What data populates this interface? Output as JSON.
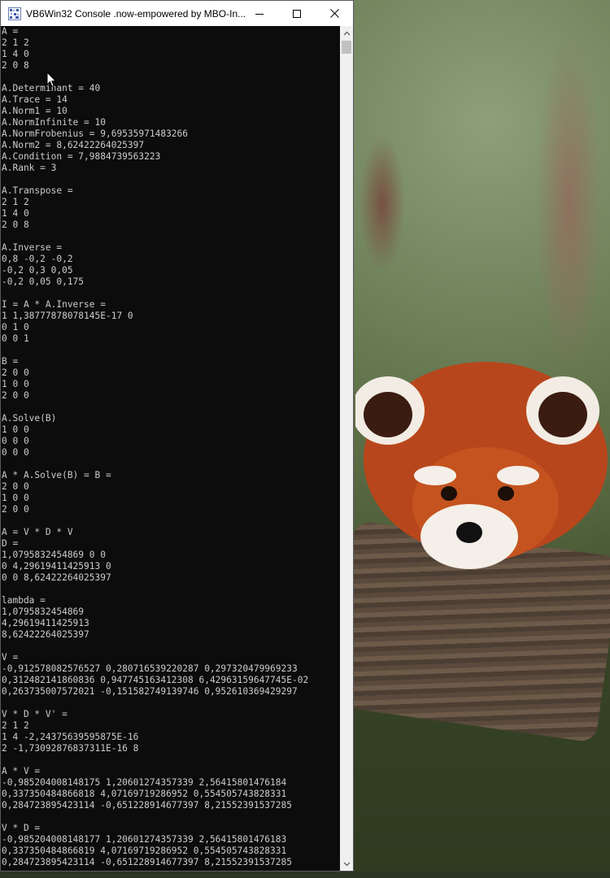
{
  "window": {
    "title": "VB6Win32 Console .now-empowered by MBO-In..."
  },
  "console": {
    "lines": [
      "A =",
      "2 1 2",
      "1 4 0",
      "2 0 8",
      "",
      "A.Determinant = 40",
      "A.Trace = 14",
      "A.Norm1 = 10",
      "A.NormInfinite = 10",
      "A.NormFrobenius = 9,69535971483266",
      "A.Norm2 = 8,62422264025397",
      "A.Condition = 7,9884739563223",
      "A.Rank = 3",
      "",
      "A.Transpose =",
      "2 1 2",
      "1 4 0",
      "2 0 8",
      "",
      "A.Inverse =",
      "0,8 -0,2 -0,2",
      "-0,2 0,3 0,05",
      "-0,2 0,05 0,175",
      "",
      "I = A * A.Inverse =",
      "1 1,38777878078145E-17 0",
      "0 1 0",
      "0 0 1",
      "",
      "B =",
      "2 0 0",
      "1 0 0",
      "2 0 0",
      "",
      "A.Solve(B)",
      "1 0 0",
      "0 0 0",
      "0 0 0",
      "",
      "A * A.Solve(B) = B =",
      "2 0 0",
      "1 0 0",
      "2 0 0",
      "",
      "A = V * D * V",
      "D =",
      "1,0795832454869 0 0",
      "0 4,29619411425913 0",
      "0 0 8,62422264025397",
      "",
      "lambda =",
      "1,0795832454869",
      "4,29619411425913",
      "8,62422264025397",
      "",
      "V =",
      "-0,912578082576527 0,280716539220287 0,297320479969233",
      "0,312482141860836 0,947745163412308 6,42963159647745E-02",
      "0,263735007572021 -0,151582749139746 0,952610369429297",
      "",
      "V * D * V' =",
      "2 1 2",
      "1 4 -2,24375639595875E-16",
      "2 -1,73092876837311E-16 8",
      "",
      "A * V =",
      "-0,985204008148175 1,20601274357339 2,56415801476184",
      "0,337350484866818 4,07169719286952 0,554505743828331",
      "0,284723895423114 -0,651228914677397 8,21552391537285",
      "",
      "V * D =",
      "-0,985204008148177 1,20601274357339 2,56415801476183",
      "0,337350484866819 4,07169719286952 0,554505743828331",
      "0,284723895423114 -0,651228914677397 8,21552391537285"
    ]
  },
  "icons": {
    "app": "app-icon",
    "minimize": "minimize-icon",
    "maximize": "maximize-icon",
    "close": "close-icon",
    "scroll_up": "chevron-up-icon",
    "scroll_down": "chevron-down-icon",
    "cursor": "mouse-pointer-icon"
  },
  "colors": {
    "console_bg": "#0c0c0c",
    "console_fg": "#cccccc",
    "title_bg": "#ffffff"
  }
}
